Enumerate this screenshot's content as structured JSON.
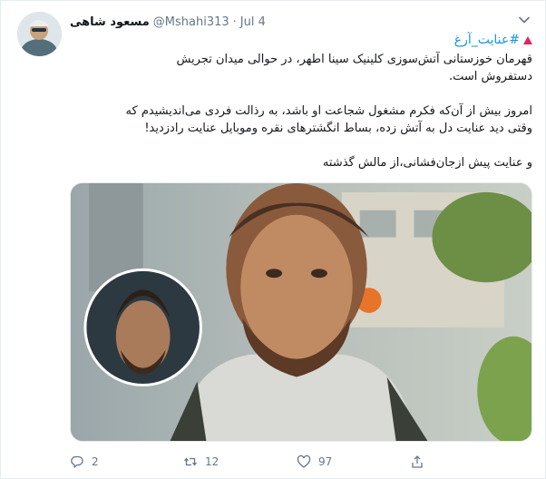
{
  "tweet": {
    "display_name": "مسعود شاهی",
    "handle": "@Mshahi313",
    "separator": "·",
    "date": "Jul 4",
    "hashtag": "#عنایت_آرغ",
    "paragraphs": [
      [
        "قهرمان خوزستانی آتش‌سوزی کلینیک سینا اطهر، در حوالی میدان تجریش",
        "دستفروش است."
      ],
      [
        "امروز بیش از آن‌که فکرم مشغول شجاعت او باشد، به رذالت فردی می‌اندیشیدم که",
        "وقتی دید عنایت دل به آتش زده، بساط انگشترهای نقره وموبایل عنایت رادزدید!"
      ],
      [
        "و عنایت پیش ازجان‌فشانی،از مالش گذشته"
      ]
    ]
  },
  "actions": {
    "reply_count": "2",
    "retweet_count": "12",
    "like_count": "97"
  },
  "icons": {
    "caret": "chevron-down-icon",
    "warning": "warning-triangle-icon",
    "reply": "reply-icon",
    "retweet": "retweet-icon",
    "like": "heart-icon",
    "share": "share-icon"
  },
  "colors": {
    "accent": "#1b95e0",
    "muted": "#657786",
    "warning": "#e0245e"
  }
}
